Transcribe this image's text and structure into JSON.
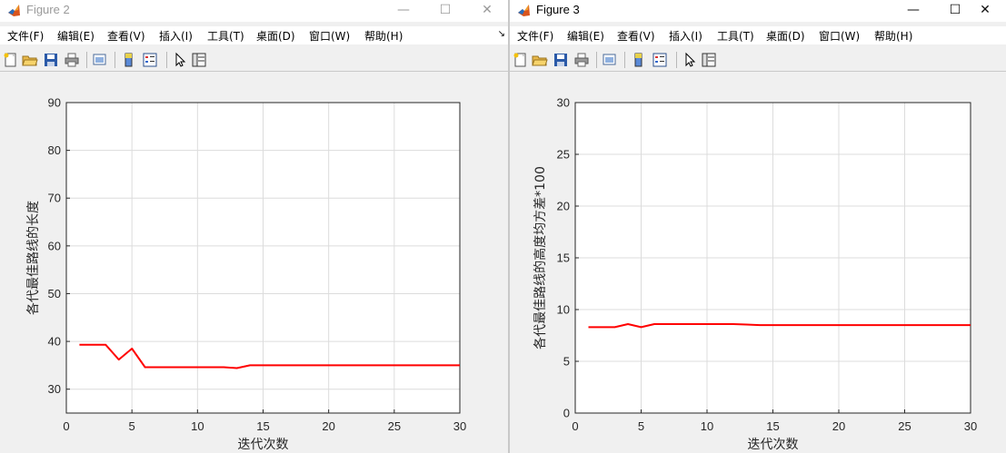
{
  "menu_items": [
    "文件(F)",
    "编辑(E)",
    "查看(V)",
    "插入(I)",
    "工具(T)",
    "桌面(D)",
    "窗口(W)",
    "帮助(H)"
  ],
  "window_controls": {
    "minimize": "—",
    "maximize": "☐",
    "close": "✕"
  },
  "colors": {
    "line": "#ff0000",
    "axes_bg": "#ffffff",
    "figure_bg": "#f0f0f0",
    "grid": "#dcdcdc"
  },
  "toolbar_icons": [
    "new-figure-icon",
    "open-file-icon",
    "save-icon",
    "print-icon",
    "link-plot-icon",
    "colorbar-icon",
    "legend-icon",
    "pointer-icon",
    "property-editor-icon"
  ],
  "fig2": {
    "title": "Figure 2",
    "menu_arrow": "↘"
  },
  "fig3": {
    "title": "Figure 3"
  },
  "chart_data": [
    {
      "type": "line",
      "xlabel": "迭代次数",
      "ylabel": "各代最佳路线的长度",
      "xlim": [
        0,
        30
      ],
      "ylim": [
        25,
        90
      ],
      "xticks": [
        0,
        5,
        10,
        15,
        20,
        25,
        30
      ],
      "yticks": [
        30,
        40,
        50,
        60,
        70,
        80,
        90
      ],
      "grid": true,
      "series": [
        {
          "color": "#ff0000",
          "x": [
            1,
            2,
            3,
            4,
            5,
            6,
            7,
            8,
            9,
            10,
            11,
            12,
            13,
            14,
            15,
            16,
            17,
            18,
            19,
            20,
            21,
            22,
            23,
            24,
            25,
            26,
            27,
            28,
            29,
            30
          ],
          "y": [
            39.3,
            39.3,
            39.3,
            36.2,
            38.5,
            34.6,
            34.6,
            34.6,
            34.6,
            34.6,
            34.6,
            34.6,
            34.4,
            35.0,
            35.0,
            35.0,
            35.0,
            35.0,
            35.0,
            35.0,
            35.0,
            35.0,
            35.0,
            35.0,
            35.0,
            35.0,
            35.0,
            35.0,
            35.0,
            35.0
          ]
        }
      ]
    },
    {
      "type": "line",
      "xlabel": "迭代次数",
      "ylabel": "各代最佳路线的高度均方差*100",
      "xlim": [
        0,
        30
      ],
      "ylim": [
        0,
        30
      ],
      "xticks": [
        0,
        5,
        10,
        15,
        20,
        25,
        30
      ],
      "yticks": [
        0,
        5,
        10,
        15,
        20,
        25,
        30
      ],
      "grid": true,
      "series": [
        {
          "color": "#ff0000",
          "x": [
            1,
            2,
            3,
            4,
            5,
            6,
            7,
            8,
            9,
            10,
            11,
            12,
            13,
            14,
            15,
            16,
            17,
            18,
            19,
            20,
            21,
            22,
            23,
            24,
            25,
            26,
            27,
            28,
            29,
            30
          ],
          "y": [
            8.3,
            8.3,
            8.3,
            8.6,
            8.3,
            8.6,
            8.6,
            8.6,
            8.6,
            8.6,
            8.6,
            8.6,
            8.55,
            8.5,
            8.5,
            8.5,
            8.5,
            8.5,
            8.5,
            8.5,
            8.5,
            8.5,
            8.5,
            8.5,
            8.5,
            8.5,
            8.5,
            8.5,
            8.5,
            8.5
          ]
        }
      ]
    }
  ]
}
